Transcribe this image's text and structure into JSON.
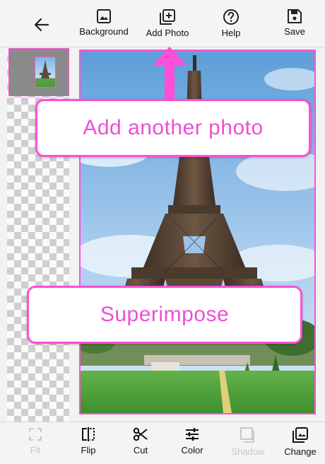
{
  "toolbar": {
    "back_icon": "arrow-left-icon",
    "items": [
      {
        "label": "Background",
        "icon": "image-icon"
      },
      {
        "label": "Add Photo",
        "icon": "add-photo-icon"
      },
      {
        "label": "Help",
        "icon": "help-icon"
      },
      {
        "label": "Save",
        "icon": "save-icon"
      }
    ]
  },
  "callouts": {
    "add_photo": "Add another photo",
    "superimpose": "Superimpose"
  },
  "bottom_toolbar": {
    "items": [
      {
        "label": "Fit",
        "icon": "fit-icon",
        "enabled": false
      },
      {
        "label": "Flip",
        "icon": "flip-icon",
        "enabled": true
      },
      {
        "label": "Cut",
        "icon": "scissors-icon",
        "enabled": true
      },
      {
        "label": "Color",
        "icon": "sliders-icon",
        "enabled": true
      },
      {
        "label": "Shadow",
        "icon": "shadow-icon",
        "enabled": false
      },
      {
        "label": "Change",
        "icon": "change-image-icon",
        "enabled": true
      }
    ]
  },
  "colors": {
    "accent": "#ff4fd8",
    "callout_text": "#ee4fd2",
    "disabled_text": "#c8c8c8"
  }
}
